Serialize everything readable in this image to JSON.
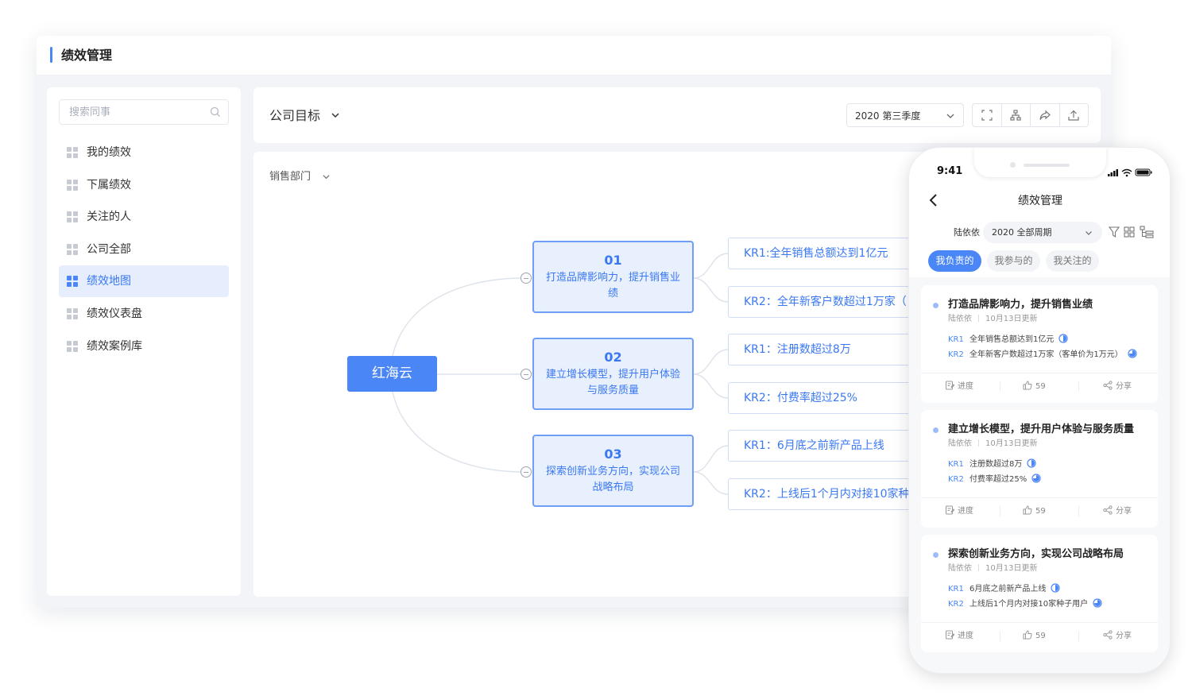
{
  "header": {
    "title": "绩效管理"
  },
  "sidebar": {
    "search_placeholder": "搜索同事",
    "items": [
      {
        "label": "我的绩效"
      },
      {
        "label": "下属绩效"
      },
      {
        "label": "关注的人"
      },
      {
        "label": "公司全部"
      },
      {
        "label": "绩效地图",
        "active": true
      },
      {
        "label": "绩效仪表盘"
      },
      {
        "label": "绩效案例库"
      }
    ]
  },
  "toolbar": {
    "goal_label": "公司目标",
    "period": "2020 第三季度",
    "tools": [
      "fullscreen-icon",
      "org-chart-icon",
      "share-icon",
      "export-icon"
    ]
  },
  "map": {
    "department": "销售部门",
    "root": "红海云",
    "objectives": [
      {
        "num": "01",
        "text": "打造品牌影响力，提升销售业绩",
        "krs": [
          "KR1:全年销售总额达到1亿元",
          "KR2：全年新客户数超过1万家（"
        ]
      },
      {
        "num": "02",
        "text": "建立增长模型，提升用户体验与服务质量",
        "krs": [
          "KR1：注册数超过8万",
          "KR2：付费率超过25%"
        ]
      },
      {
        "num": "03",
        "text": "探索创新业务方向，实现公司战略布局",
        "krs": [
          "KR1：6月底之前新产品上线",
          "KR2：上线后1个月内对接10家种"
        ]
      }
    ]
  },
  "mobile": {
    "time": "9:41",
    "title": "绩效管理",
    "user": "陆依依",
    "period": "2020 全部周期",
    "tabs": [
      "我负责的",
      "我参与的",
      "我关注的"
    ],
    "cards": [
      {
        "title": "打造品牌影响力，提升销售业绩",
        "owner": "陆依依",
        "updated": "10月13日更新",
        "krs": [
          {
            "label": "KR1",
            "text": "全年销售总额达到1亿元",
            "progress": 0.5
          },
          {
            "label": "KR2",
            "text": "全年新客户数超过1万家（客单价为1万元）",
            "progress": 0.75
          }
        ],
        "actions": {
          "progress": "进度",
          "likes": "59",
          "share": "分享"
        }
      },
      {
        "title": "建立增长模型，提升用户体验与服务质量",
        "owner": "陆依依",
        "updated": "10月13日更新",
        "krs": [
          {
            "label": "KR1",
            "text": "注册数超过8万",
            "progress": 0.5
          },
          {
            "label": "KR2",
            "text": "付费率超过25%",
            "progress": 0.75
          }
        ],
        "actions": {
          "progress": "进度",
          "likes": "59",
          "share": "分享"
        }
      },
      {
        "title": "探索创新业务方向，实现公司战略布局",
        "owner": "陆依依",
        "updated": "10月13日更新",
        "krs": [
          {
            "label": "KR1",
            "text": "6月底之前新产品上线",
            "progress": 0.5
          },
          {
            "label": "KR2",
            "text": "上线后1个月内对接10家种子用户",
            "progress": 0.75
          }
        ],
        "actions": {
          "progress": "进度",
          "likes": "59",
          "share": "分享"
        }
      }
    ]
  },
  "colors": {
    "accent": "#4a86f5",
    "accent_light": "#e8effd",
    "border": "#6f9ef7"
  }
}
